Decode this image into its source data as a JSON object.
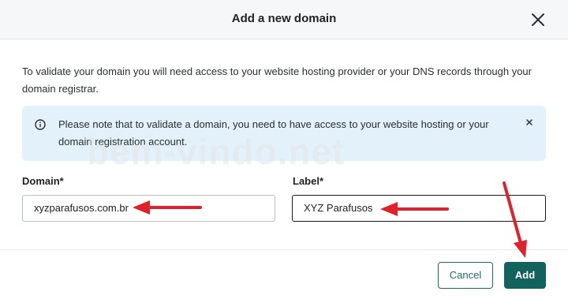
{
  "dialog": {
    "title": "Add a new domain",
    "intro": "To validate your domain you will need access to your website hosting provider or your DNS records through your domain registrar."
  },
  "notice": {
    "message": "Please note that to validate a domain, you need to have access to your website hosting or your domain registration account."
  },
  "watermark": {
    "text": "bem-vindo.net"
  },
  "form": {
    "domain_label": "Domain*",
    "domain_value": "xyzparafusos.com.br",
    "label_label": "Label*",
    "label_value": "XYZ Parafusos"
  },
  "footer": {
    "cancel_label": "Cancel",
    "add_label": "Add"
  },
  "colors": {
    "primary": "#12635e",
    "notice_bg": "#e3f1fb",
    "annotation_arrow": "#e0202a"
  },
  "icons": [
    "close-icon",
    "info-icon",
    "dismiss-icon",
    "arrow-annotation"
  ]
}
